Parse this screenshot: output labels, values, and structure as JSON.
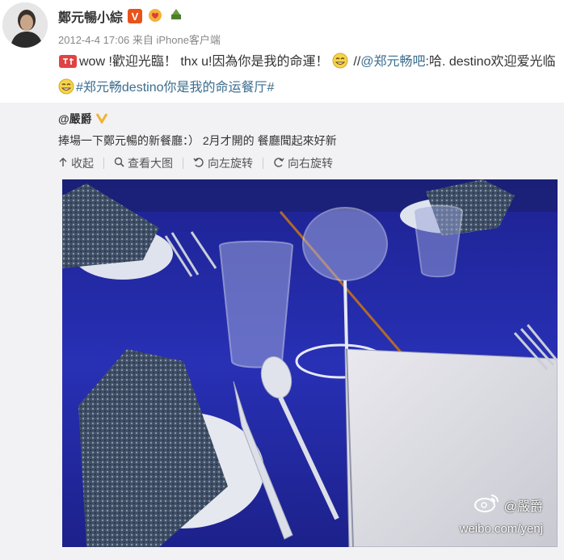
{
  "post": {
    "author_name": "鄭元暢小綜",
    "timestamp": "2012-4-4 17:06",
    "source_prefix": "来自",
    "source_name": "iPhone客户端",
    "text_part1": "wow !歡迎光臨！ thx u!因為你是我的命運！",
    "text_part2": " //",
    "mention": "@郑元畅吧",
    "text_part3": ":哈. destino欢迎爱光临",
    "hashtag": "#郑元畅destino你是我的命运餐厅#",
    "emoji_icon": "grin-emoji-icon"
  },
  "repost": {
    "original_user": "@嚴爵",
    "original_text": "捧場一下鄭元暢的新餐廳：）  2月才開的 餐廳聞起來好新",
    "actions": {
      "collapse": "收起",
      "view_large": "查看大图",
      "rotate_left": "向左旋转",
      "rotate_right": "向右旋转"
    },
    "watermark_name": "@嚴爵",
    "watermark_url": "weibo.com/yenj"
  },
  "colors": {
    "link": "#3b6d8e",
    "badge": "#e8531c",
    "tablecloth": "#2a2fb8"
  }
}
